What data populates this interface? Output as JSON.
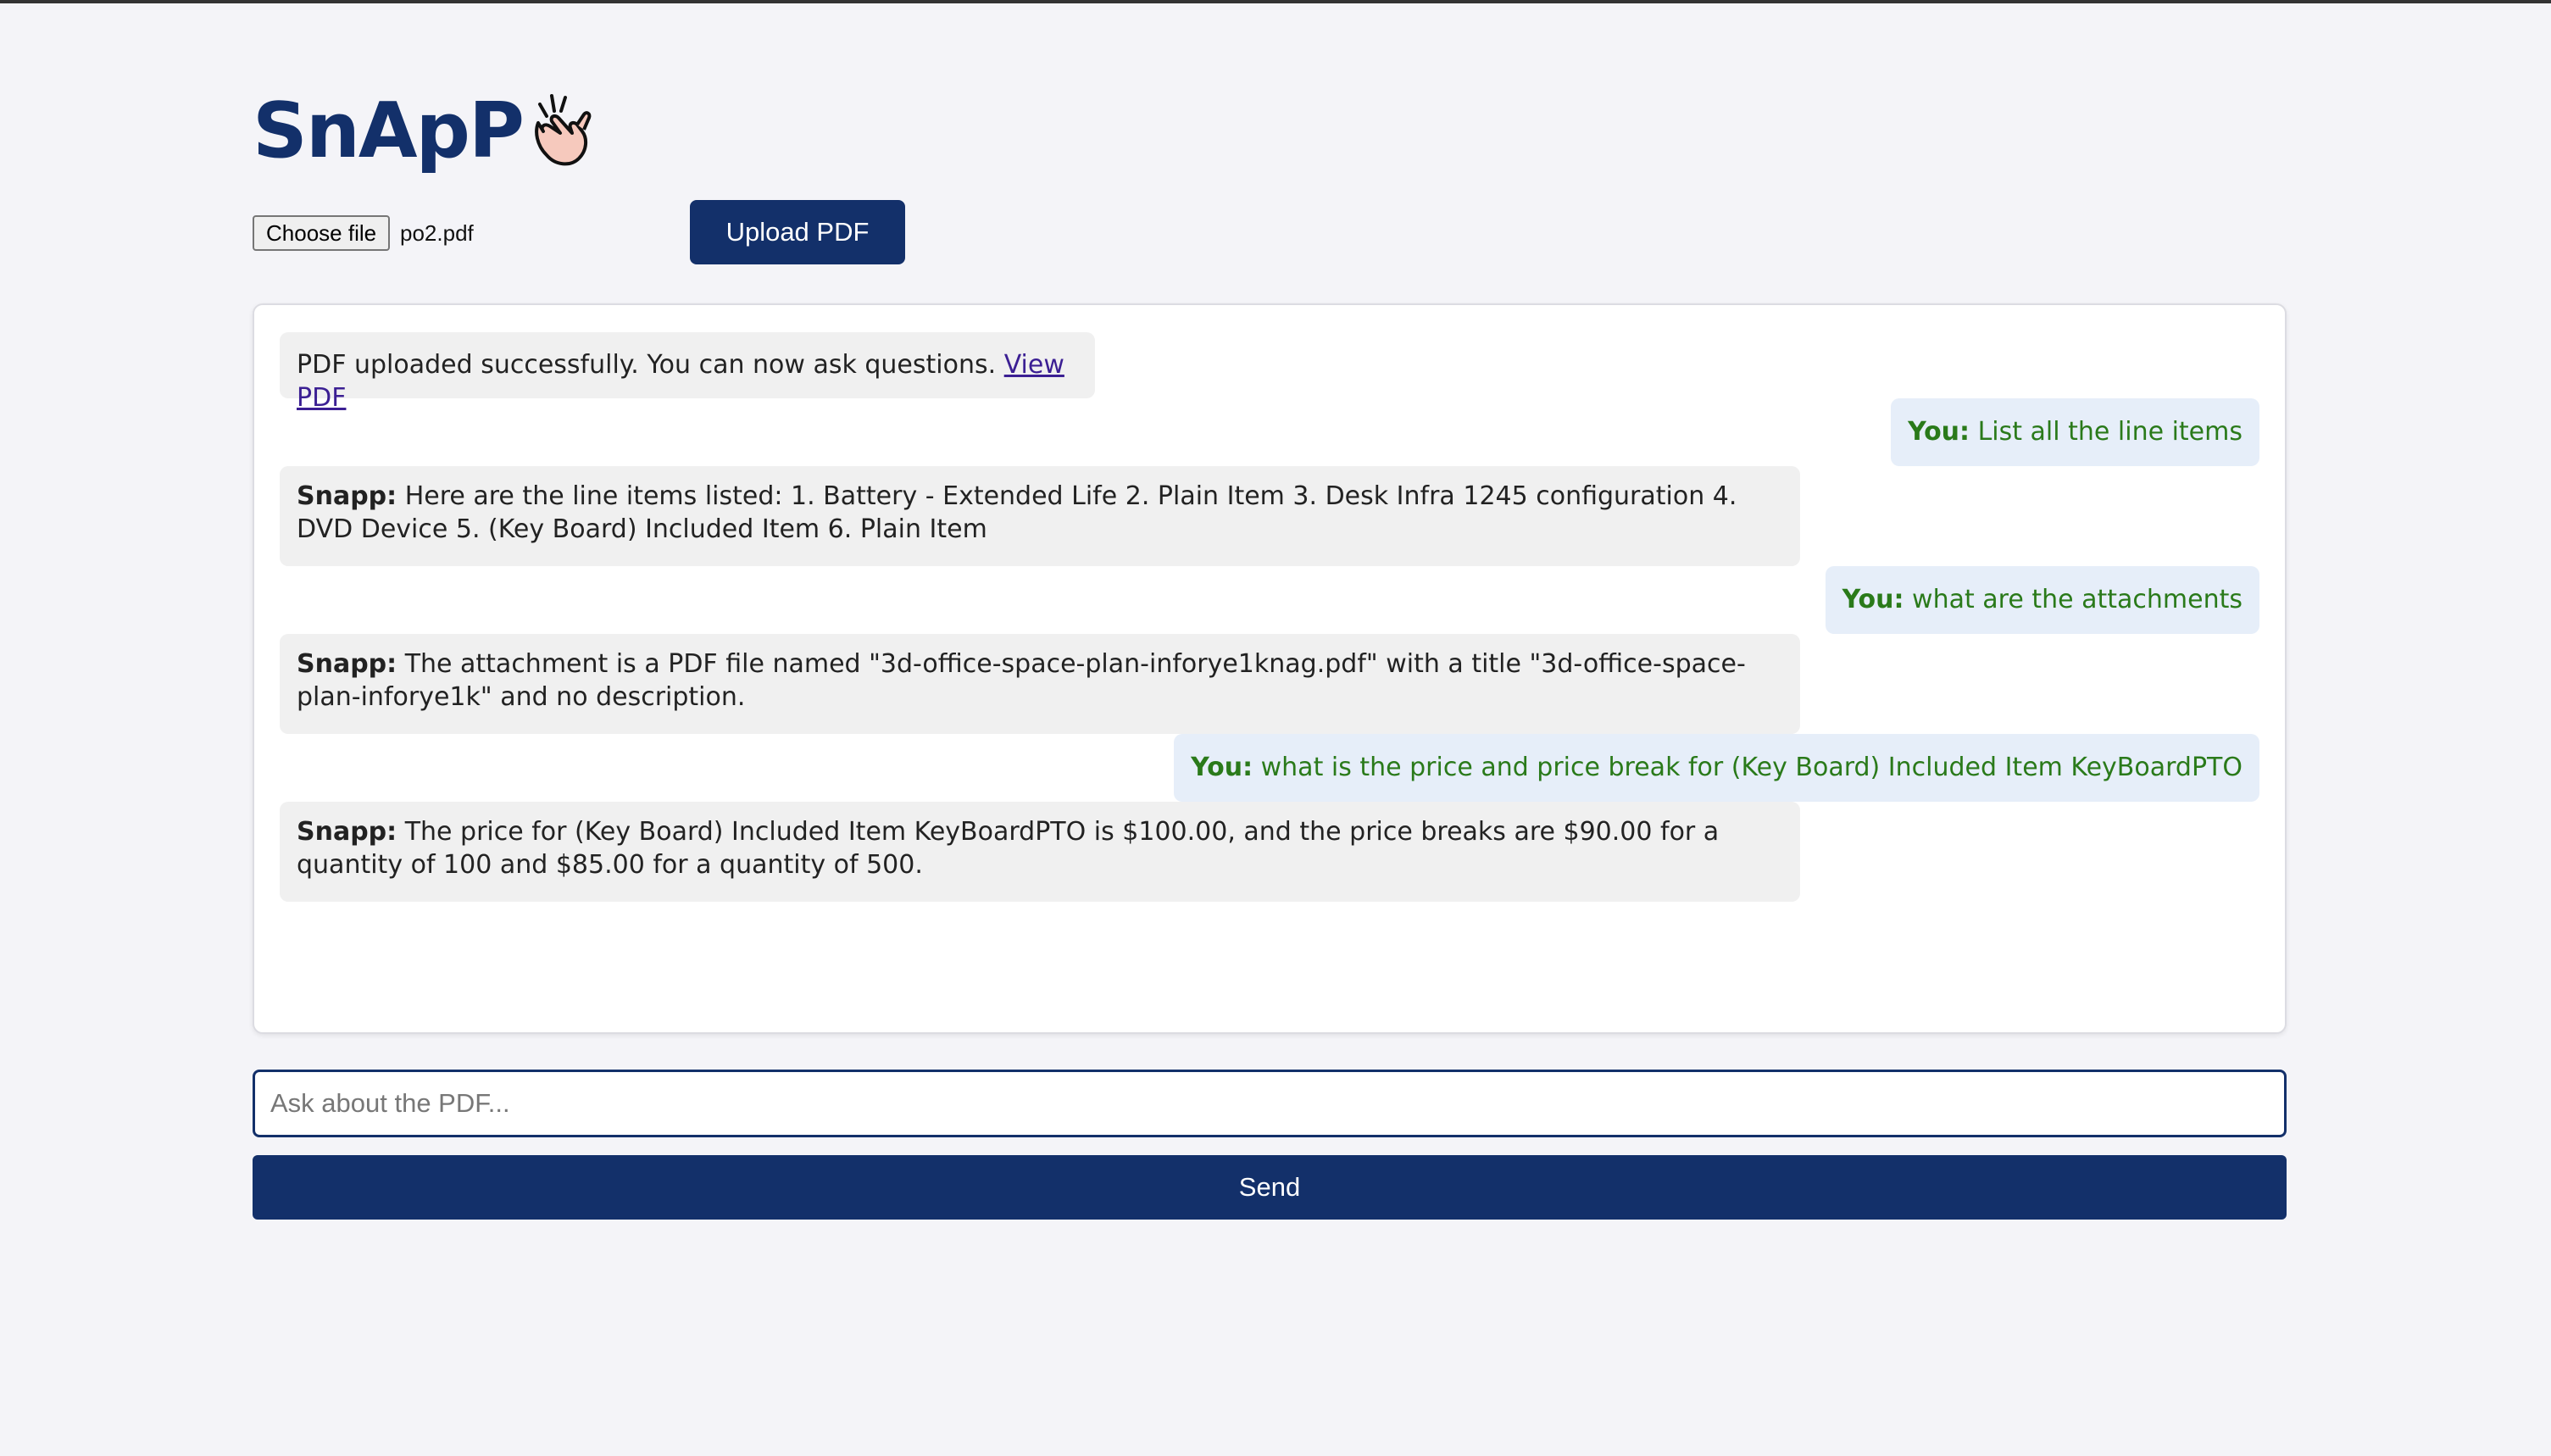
{
  "app": {
    "title": "SnApP",
    "logo_icon": "snapping-fingers-icon"
  },
  "upload": {
    "choose_label": "Choose file",
    "file_name": "po2.pdf",
    "upload_label": "Upload PDF"
  },
  "chat": {
    "system": {
      "text": "PDF uploaded successfully. You can now ask questions. ",
      "link_label": "View PDF"
    },
    "messages": [
      {
        "role": "user",
        "speaker": "You:",
        "text": " List all the line items"
      },
      {
        "role": "bot",
        "speaker": "Snapp:",
        "text": " Here are the line items listed: 1. Battery - Extended Life 2. Plain Item 3. Desk Infra 1245 configuration 4. DVD Device 5. (Key Board) Included Item 6. Plain Item"
      },
      {
        "role": "user",
        "speaker": "You:",
        "text": " what are the attachments"
      },
      {
        "role": "bot",
        "speaker": "Snapp:",
        "text": " The attachment is a PDF file named \"3d-office-space-plan-inforye1knag.pdf\" with a title \"3d-office-space-plan-inforye1k\" and no description."
      },
      {
        "role": "user",
        "speaker": "You:",
        "text": " what is the price and price break for (Key Board) Included Item KeyBoardPTO"
      },
      {
        "role": "bot",
        "speaker": "Snapp:",
        "text": " The price for (Key Board) Included Item KeyBoardPTO is $100.00, and the price breaks are $90.00 for a quantity of 100 and $85.00 for a quantity of 500."
      }
    ]
  },
  "input": {
    "placeholder": "Ask about the PDF...",
    "value": ""
  },
  "send": {
    "label": "Send"
  },
  "colors": {
    "brand": "#13306a",
    "user_text": "#2a7a1a",
    "user_bubble": "#e6eef9",
    "bot_bubble": "#f0f0f0"
  }
}
